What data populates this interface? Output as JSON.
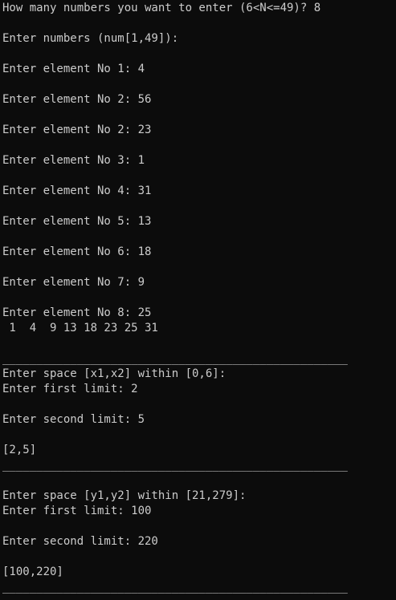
{
  "terminal": {
    "lines": [
      "How many numbers you want to enter (6<N<=49)? 8",
      "",
      "Enter numbers (num[1,49]):",
      "",
      "Enter element No 1: 4",
      "",
      "Enter element No 2: 56",
      "",
      "Enter element No 2: 23",
      "",
      "Enter element No 3: 1",
      "",
      "Enter element No 4: 31",
      "",
      "Enter element No 5: 13",
      "",
      "Enter element No 6: 18",
      "",
      "Enter element No 7: 9",
      "",
      "Enter element No 8: 25",
      " 1  4  9 13 18 23 25 31",
      "",
      "___________________________________________________",
      "Enter space [x1,x2] within [0,6]:",
      "Enter first limit: 2",
      "",
      "Enter second limit: 5",
      "",
      "[2,5]",
      "___________________________________________________",
      "",
      "Enter space [y1,y2] within [21,279]:",
      "Enter first limit: 100",
      "",
      "Enter second limit: 220",
      "",
      "[100,220]",
      "___________________________________________________"
    ]
  }
}
